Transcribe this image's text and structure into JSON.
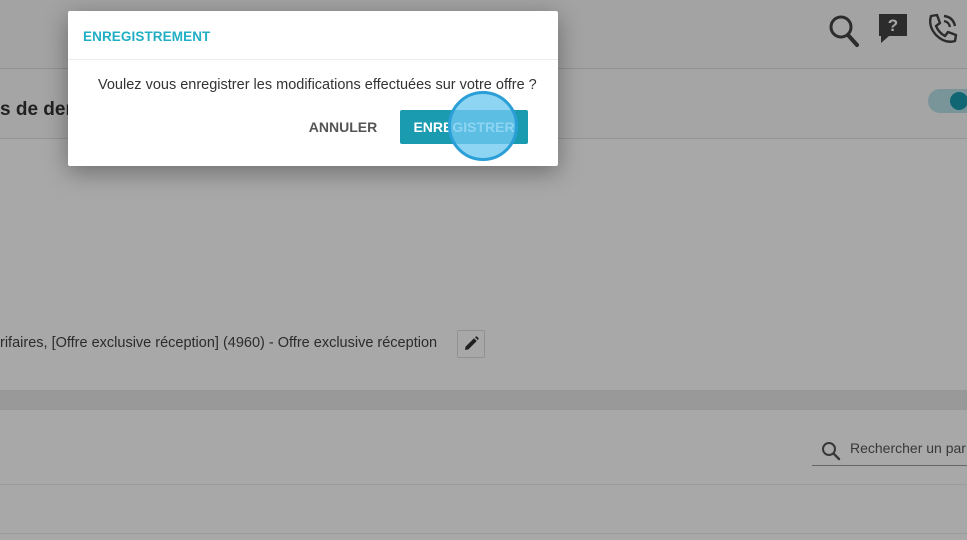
{
  "app": {
    "subheader_title": "s de der",
    "offer_line": "rifaires, [Offre exclusive réception] (4960) - Offre exclusive réception",
    "search": {
      "placeholder": "Rechercher un par"
    },
    "icons": {
      "search": "search-icon",
      "help": "help-question-icon",
      "phone": "phone-call-icon",
      "edit": "pencil-icon"
    }
  },
  "dialog": {
    "title": "ENREGISTREMENT",
    "message": "Voulez vous enregistrer les modifications effectuées sur votre offre ?",
    "cancel_label": "ANNULER",
    "save_label": "ENREGISTRER"
  },
  "colors": {
    "accent": "#1a9bb0",
    "title": "#21afc4",
    "overlay": "rgba(0,0,0,0.34)"
  }
}
